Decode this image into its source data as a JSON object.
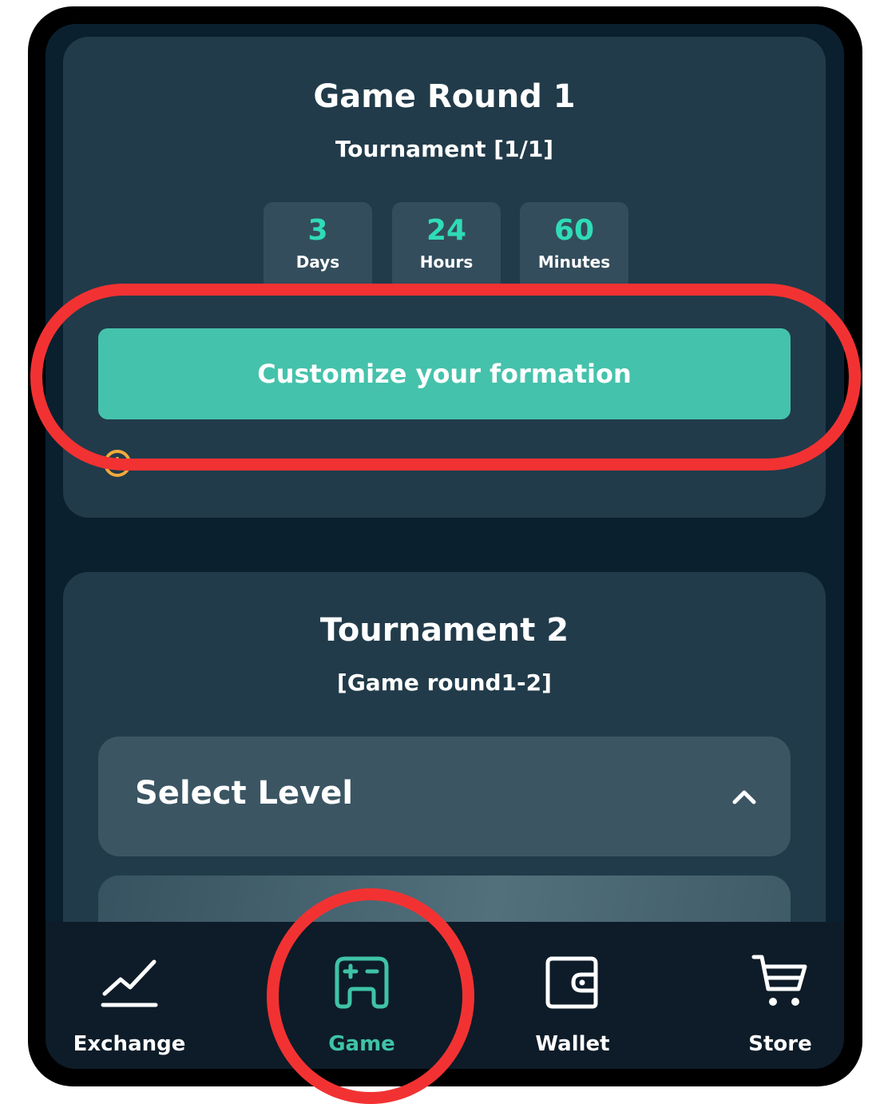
{
  "round_card": {
    "title": "Game Round 1",
    "subtitle": "Tournament [1/1]",
    "countdown": [
      {
        "value": "3",
        "label": "Days"
      },
      {
        "value": "24",
        "label": "Hours"
      },
      {
        "value": "60",
        "label": "Minutes"
      }
    ],
    "cta_label": "Customize your formation",
    "notice_icon": "info-icon"
  },
  "tournament_card": {
    "title": "Tournament 2",
    "subtitle": "[Game round1-2]",
    "select_label": "Select Level",
    "select_icon": "chevron-up-icon"
  },
  "tab_bar": {
    "tabs": [
      {
        "label": "Exchange",
        "icon": "chart-line-icon",
        "active": false
      },
      {
        "label": "Game",
        "icon": "gamepad-icon",
        "active": true
      },
      {
        "label": "Wallet",
        "icon": "wallet-icon",
        "active": false
      },
      {
        "label": "Store",
        "icon": "cart-icon",
        "active": false
      }
    ]
  },
  "colors": {
    "accent": "#45c2ab",
    "countdown_number": "#2fdcb8",
    "warning": "#f2a93b",
    "annotation": "#f23232",
    "background": "#0a202f",
    "card": "#213b4a"
  }
}
